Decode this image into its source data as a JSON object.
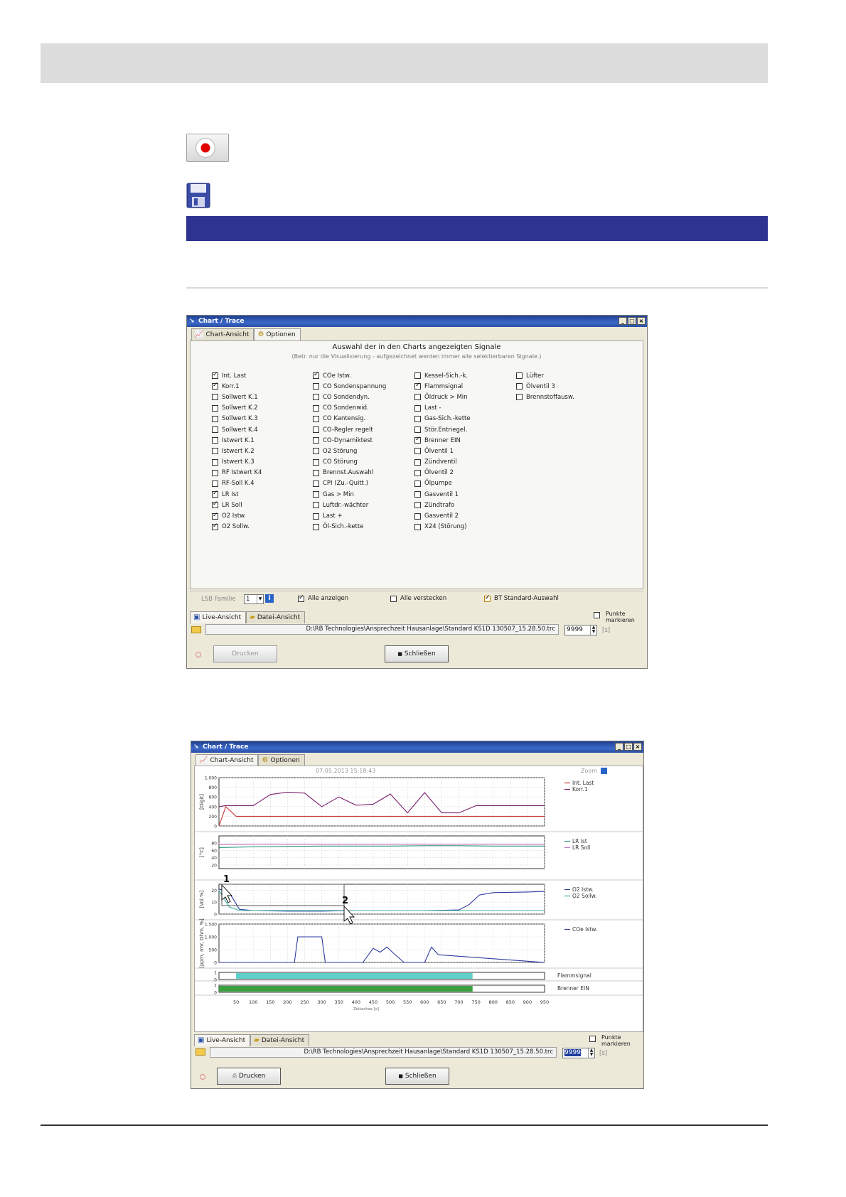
{
  "options_window": {
    "title": "Chart / Trace",
    "tabs": [
      "Chart-Ansicht",
      "Optionen"
    ],
    "heading": "Auswahl der in den Charts angezeigten Signale",
    "subheading": "(Betr. nur die Visualisierung - aufgezeichnet werden immer alle selektierbaren Signale.)",
    "columns": [
      [
        {
          "label": "Int. Last",
          "checked": true
        },
        {
          "label": "Korr.1",
          "checked": true
        },
        {
          "label": "Sollwert K.1",
          "checked": false
        },
        {
          "label": "Sollwert K.2",
          "checked": false
        },
        {
          "label": "Sollwert K.3",
          "checked": false
        },
        {
          "label": "Sollwert K.4",
          "checked": false
        },
        {
          "label": "Istwert K.1",
          "checked": false
        },
        {
          "label": "Istwert K.2",
          "checked": false
        },
        {
          "label": "Istwert K.3",
          "checked": false
        },
        {
          "label": "RF Istwert K4",
          "checked": false
        },
        {
          "label": "RF-Soll K.4",
          "checked": false
        },
        {
          "label": "LR Ist",
          "checked": true
        },
        {
          "label": "LR Soll",
          "checked": true
        },
        {
          "label": "O2 Istw.",
          "checked": true
        },
        {
          "label": "O2 Sollw.",
          "checked": true
        }
      ],
      [
        {
          "label": "COe Istw.",
          "checked": true
        },
        {
          "label": "CO Sondenspannung",
          "checked": false
        },
        {
          "label": "CO Sondendyn.",
          "checked": false
        },
        {
          "label": "CO Sondenwid.",
          "checked": false
        },
        {
          "label": "CO Kantensig.",
          "checked": false
        },
        {
          "label": "CO-Regler regelt",
          "checked": false
        },
        {
          "label": "CO-Dynamiktest",
          "checked": false
        },
        {
          "label": "O2 Störung",
          "checked": false
        },
        {
          "label": "CO Störung",
          "checked": false
        },
        {
          "label": "Brennst.Auswahl",
          "checked": false
        },
        {
          "label": "CPI (Zu.-Quitt.)",
          "checked": false
        },
        {
          "label": "Gas > Min",
          "checked": false
        },
        {
          "label": "Luftdr.-wächter",
          "checked": false
        },
        {
          "label": "Last +",
          "checked": false
        },
        {
          "label": "Öl-Sich.-kette",
          "checked": false
        }
      ],
      [
        {
          "label": "Kessel-Sich.-k.",
          "checked": false
        },
        {
          "label": "Flammsignal",
          "checked": true
        },
        {
          "label": "Öldruck > Min",
          "checked": false
        },
        {
          "label": "Last -",
          "checked": false
        },
        {
          "label": "Gas-Sich.-kette",
          "checked": false
        },
        {
          "label": "Stör.Entriegel.",
          "checked": false
        },
        {
          "label": "Brenner EIN",
          "checked": true
        },
        {
          "label": "Ölventil 1",
          "checked": false
        },
        {
          "label": "Zündventil",
          "checked": false
        },
        {
          "label": "Ölventil 2",
          "checked": false
        },
        {
          "label": "Ölpumpe",
          "checked": false
        },
        {
          "label": "Gasventil 1",
          "checked": false
        },
        {
          "label": "Zündtrafo",
          "checked": false
        },
        {
          "label": "Gasventil 2",
          "checked": false
        },
        {
          "label": "X24 (Störung)",
          "checked": false
        }
      ],
      [
        {
          "label": "Lüfter",
          "checked": false
        },
        {
          "label": "Ölventil 3",
          "checked": false
        },
        {
          "label": "Brennstoffausw.",
          "checked": false
        }
      ]
    ],
    "footer": {
      "lsb_label": "LSB Familie",
      "lsb_value": "1",
      "show_all": "Alle anzeigen",
      "hide_all": "Alle verstecken",
      "bt_default": "BT Standard-Auswahl"
    },
    "lower_tabs": [
      "Live-Ansicht",
      "Datei-Ansicht"
    ],
    "points_label": "Punkte markieren",
    "path": "D:\\RB Technologies\\Ansprechzeit Hausanlage\\Standard KS1D 130507_15.28.50.trc",
    "spin_value": "9999",
    "unit": "[s]",
    "print_button": "Drucken",
    "close_button": "Schließen"
  },
  "chart_window": {
    "title": "Chart / Trace",
    "tabs": [
      "Chart-Ansicht",
      "Optionen"
    ],
    "timestamp": "07.05.2013  15:18:43",
    "zoom_label": "Zoom",
    "lower_tabs": [
      "Live-Ansicht",
      "Datei-Ansicht"
    ],
    "points_label": "Punkte markieren",
    "path": "D:\\RB Technologies\\Ansprechzeit Hausanlage\\Standard KS1D 130507_15.28.50.trc",
    "spin_value": "9999",
    "unit": "[s]",
    "print_button": "Drucken",
    "close_button": "Schließen",
    "callouts": [
      "1",
      "2"
    ]
  },
  "chart_data": [
    {
      "type": "line",
      "ylabel": "[Digit]",
      "ylim": [
        0,
        1000
      ],
      "yticks": [
        "0",
        "200",
        "400",
        "600",
        "800",
        "1.000"
      ],
      "x": [
        0,
        20,
        50,
        100,
        150,
        200,
        250,
        300,
        350,
        400,
        450,
        500,
        550,
        600,
        650,
        700,
        750,
        800,
        850,
        900,
        950
      ],
      "series": [
        {
          "name": "Int. Last",
          "color": "#cc3333",
          "values": [
            0,
            400,
            200,
            200,
            200,
            200,
            200,
            200,
            200,
            200,
            200,
            200,
            200,
            200,
            200,
            200,
            200,
            200,
            200,
            200,
            200
          ]
        },
        {
          "name": "Korr.1",
          "color": "#7a1f6e",
          "values": [
            400,
            420,
            420,
            420,
            650,
            700,
            680,
            400,
            600,
            430,
            450,
            660,
            270,
            690,
            270,
            270,
            420,
            420,
            420,
            420,
            420
          ]
        }
      ],
      "legend_position": "right"
    },
    {
      "type": "line",
      "ylabel": "[°C]",
      "ylim": [
        10,
        100
      ],
      "yticks": [
        "20",
        "40",
        "60",
        "80"
      ],
      "x": [
        0,
        100,
        200,
        300,
        400,
        500,
        600,
        700,
        800,
        950
      ],
      "series": [
        {
          "name": "LR Ist",
          "color": "#2a9a7a",
          "values": [
            68,
            70,
            71,
            72,
            72,
            72,
            73,
            73,
            72,
            72
          ]
        },
        {
          "name": "LR Soll",
          "color": "#c870c0",
          "values": [
            76,
            77,
            77,
            77,
            77,
            77,
            77,
            77,
            77,
            77
          ]
        }
      ],
      "legend_position": "right"
    },
    {
      "type": "line",
      "ylabel": "[Vol.%]",
      "ylim": [
        0,
        25
      ],
      "yticks": [
        "0",
        "10",
        "20"
      ],
      "x": [
        0,
        30,
        60,
        100,
        200,
        300,
        400,
        500,
        600,
        700,
        730,
        760,
        800,
        900,
        950
      ],
      "series": [
        {
          "name": "O2 Istw.",
          "color": "#2e3aa0",
          "values": [
            21,
            18,
            4,
            3,
            2.5,
            2.5,
            3,
            3,
            3,
            3.5,
            8,
            16,
            18,
            18.5,
            19
          ]
        },
        {
          "name": "O2 Sollw.",
          "color": "#3cb0a0",
          "values": [
            20,
            6,
            3,
            3,
            3,
            3,
            3,
            3,
            3,
            3,
            3,
            3,
            3,
            3,
            3
          ]
        }
      ],
      "legend_position": "right"
    },
    {
      "type": "line",
      "ylabel": "[ppm, mV, Ohm, %]",
      "ylim": [
        0,
        1500
      ],
      "yticks": [
        "0",
        "500",
        "1.000",
        "1.500"
      ],
      "x": [
        0,
        220,
        230,
        300,
        310,
        420,
        450,
        470,
        490,
        510,
        540,
        600,
        620,
        640,
        950
      ],
      "series": [
        {
          "name": "COe Istw.",
          "color": "#2e3aa0",
          "values": [
            0,
            0,
            1000,
            1000,
            0,
            0,
            550,
            400,
            600,
            350,
            0,
            0,
            600,
            300,
            0
          ]
        }
      ],
      "legend_position": "right"
    },
    {
      "type": "area",
      "ylim": [
        0,
        1
      ],
      "yticks": [
        "0",
        "1"
      ],
      "series": [
        {
          "name": "Flammsignal",
          "color": "#5fd0c8",
          "on_from": 50,
          "on_to": 740
        }
      ],
      "legend_position": "right"
    },
    {
      "type": "area",
      "ylim": [
        0,
        1
      ],
      "yticks": [
        "0",
        "1"
      ],
      "xlabel": "Zeitachse [s]",
      "xticks": [
        "50",
        "100",
        "150",
        "200",
        "250",
        "300",
        "350",
        "400",
        "450",
        "500",
        "550",
        "600",
        "650",
        "700",
        "750",
        "800",
        "850",
        "900",
        "950"
      ],
      "series": [
        {
          "name": "Brenner EIN",
          "color": "#3aa040",
          "on_from": 0,
          "on_to": 740
        }
      ],
      "legend_position": "right"
    }
  ]
}
